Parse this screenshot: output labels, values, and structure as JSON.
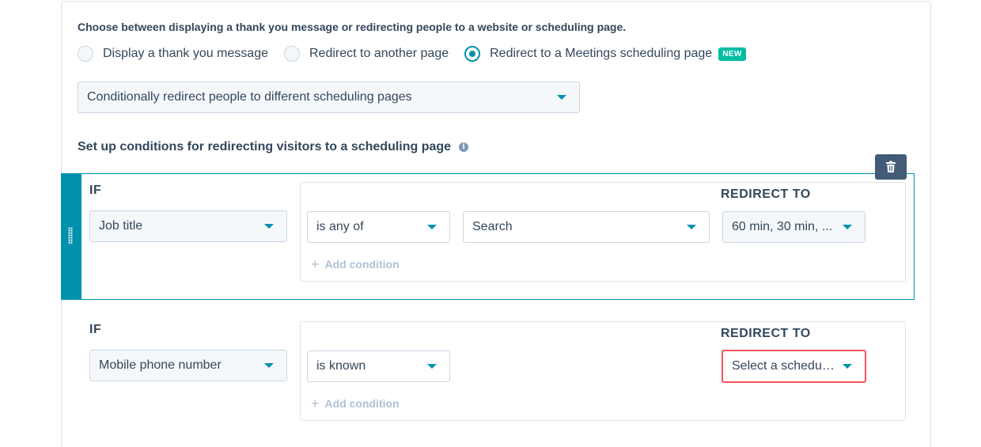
{
  "intro_text": "Choose between displaying a thank you message or redirecting people to a website or scheduling page.",
  "options": [
    {
      "label": "Display a thank you message",
      "selected": false
    },
    {
      "label": "Redirect to another page",
      "selected": false
    },
    {
      "label": "Redirect to a Meetings scheduling page",
      "selected": true
    }
  ],
  "new_badge": "NEW",
  "mode_select": {
    "value": "Conditionally redirect people to different scheduling pages"
  },
  "section_title": "Set up conditions for redirecting visitors to a scheduling page",
  "info_icon_glyph": "i",
  "rules": [
    {
      "if_label": "IF",
      "property": "Job title",
      "operator": "is any of",
      "value": "Search",
      "redirect_label": "REDIRECT TO",
      "redirect_value": "60 min, 30 min, ...",
      "add_condition": "Add condition"
    },
    {
      "if_label": "IF",
      "property": "Mobile phone number",
      "operator": "is known",
      "redirect_label": "REDIRECT TO",
      "redirect_value": "Select a scheduli...",
      "add_condition": "Add condition"
    }
  ],
  "icons": {
    "trash": "trash-icon",
    "info": "info-icon",
    "drag": "drag-handle-icon",
    "plus": "plus-icon",
    "caret": "caret-down-icon"
  },
  "colors": {
    "accent": "#0091ae",
    "new_badge": "#00bda5",
    "error": "#f2545b",
    "trash_bg": "#425b76",
    "text": "#33475b"
  }
}
